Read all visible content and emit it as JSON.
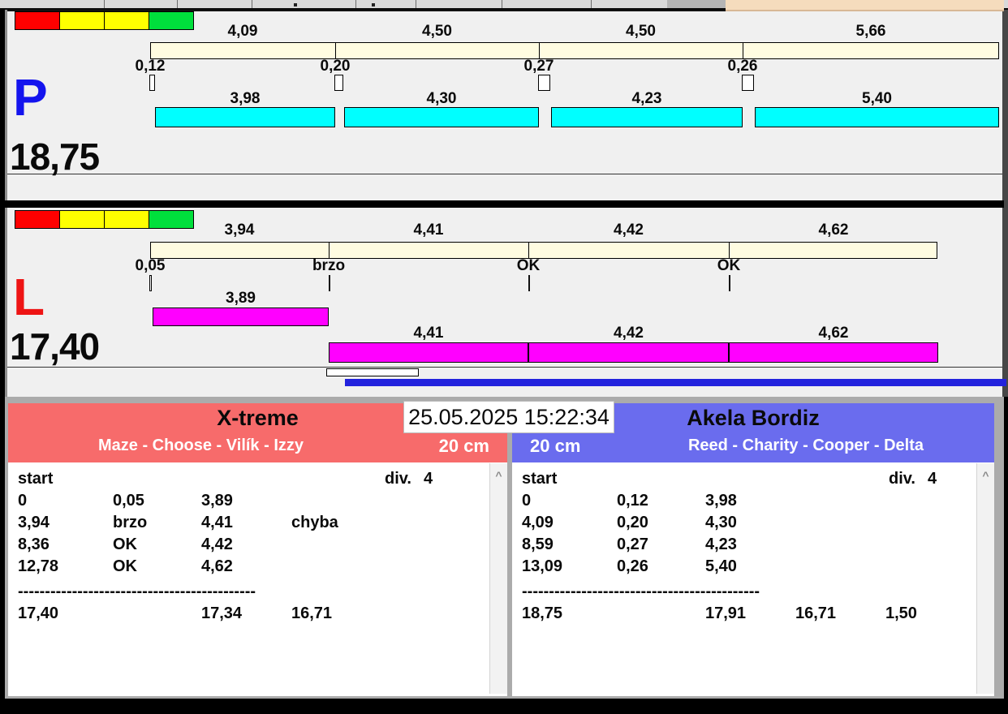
{
  "datetime": "25.05.2025 15:22:34",
  "icons": {
    "scroll_up_glyph": "^"
  },
  "colors": {
    "background": "#f0f0f0",
    "split_bar": "#fffce1",
    "lane_p_run": "#00ffff",
    "lane_l_run": "#ff00ff",
    "lane_p_letter": "#1414ee",
    "lane_l_letter": "#ee1414",
    "team_left_accent": "#f76b6b",
    "team_right_accent": "#6a6cee",
    "progress_blue": "#2222dd",
    "lights": [
      "#ff0000",
      "#ffff00",
      "#ffff00",
      "#00df3c"
    ]
  },
  "lanes": [
    {
      "letter": "P",
      "total": "18,75",
      "splits": [
        {
          "time_label": "4,09",
          "seconds": 4.09,
          "offset_label": "0,12",
          "offset_seconds": 0.12,
          "marker": "box",
          "run_label": "3,98",
          "run_seconds": 3.98,
          "run_row": 0
        },
        {
          "time_label": "4,50",
          "seconds": 4.5,
          "offset_label": "0,20",
          "offset_seconds": 0.2,
          "marker": "box",
          "run_label": "4,30",
          "run_seconds": 4.3,
          "run_row": 0
        },
        {
          "time_label": "4,50",
          "seconds": 4.5,
          "offset_label": "0,27",
          "offset_seconds": 0.27,
          "marker": "box",
          "run_label": "4,23",
          "run_seconds": 4.23,
          "run_row": 0
        },
        {
          "time_label": "5,66",
          "seconds": 5.66,
          "offset_label": "0,26",
          "offset_seconds": 0.26,
          "marker": "box",
          "run_label": "5,40",
          "run_seconds": 5.4,
          "run_row": 0
        }
      ]
    },
    {
      "letter": "L",
      "total": "17,40",
      "splits": [
        {
          "time_label": "3,94",
          "seconds": 3.94,
          "offset_label": "0,05",
          "offset_seconds": 0.05,
          "marker": "box",
          "run_label": "3,89",
          "run_seconds": 3.89,
          "run_row": 0
        },
        {
          "time_label": "4,41",
          "seconds": 4.41,
          "offset_label": "brzo",
          "marker": "tick",
          "run_label": "4,41",
          "run_seconds": 4.41,
          "run_row": 1
        },
        {
          "time_label": "4,42",
          "seconds": 4.42,
          "offset_label": "OK",
          "marker": "tick",
          "run_label": "4,42",
          "run_seconds": 4.42,
          "run_row": 1
        },
        {
          "time_label": "4,62",
          "seconds": 4.62,
          "offset_label": "OK",
          "marker": "tick",
          "run_label": "4,62",
          "run_seconds": 4.62,
          "run_row": 1
        }
      ]
    }
  ],
  "teams": [
    {
      "name": "X-treme",
      "dogs": "Maze - Choose - Vilík - Izzy",
      "height_class": "20 cm",
      "table": {
        "header_left": "start",
        "division_label": "div.",
        "division_value": "4",
        "rows": [
          [
            "0",
            "0,05",
            "3,89",
            ""
          ],
          [
            "3,94",
            "brzo",
            "4,41",
            "chyba"
          ],
          [
            "8,36",
            "OK",
            "4,42",
            ""
          ],
          [
            "12,78",
            "OK",
            "4,62",
            ""
          ]
        ],
        "separator": "--------------------------------------------",
        "totals": [
          "17,40",
          "",
          "17,34",
          "16,71",
          ""
        ]
      }
    },
    {
      "name": "Akela Bordiz",
      "dogs": "Reed - Charity - Cooper - Delta",
      "height_class": "20 cm",
      "table": {
        "header_left": "start",
        "division_label": "div.",
        "division_value": "4",
        "rows": [
          [
            "0",
            "0,12",
            "3,98",
            ""
          ],
          [
            "4,09",
            "0,20",
            "4,30",
            ""
          ],
          [
            "8,59",
            "0,27",
            "4,23",
            ""
          ],
          [
            "13,09",
            "0,26",
            "5,40",
            ""
          ]
        ],
        "separator": "--------------------------------------------",
        "totals": [
          "18,75",
          "",
          "17,91",
          "16,71",
          "1,50"
        ]
      }
    }
  ]
}
